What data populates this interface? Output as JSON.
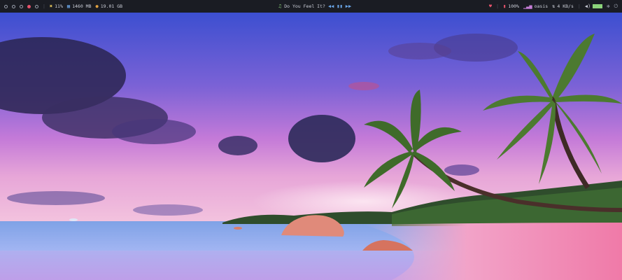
{
  "workspaces": [
    {
      "id": 1,
      "active": false
    },
    {
      "id": 2,
      "active": false
    },
    {
      "id": 3,
      "active": false
    },
    {
      "id": 4,
      "active": true
    },
    {
      "id": 5,
      "active": false
    }
  ],
  "status_left": {
    "cpu": "11%",
    "memory": "1460 MB",
    "disk": "19.01 GB"
  },
  "media": {
    "title": "Do You Feel It?"
  },
  "status_right": {
    "brightness": "100%",
    "wifi": "oasis",
    "net_speed": "4 KB/s"
  },
  "colors": {
    "bar_bg": "#1a1c23",
    "accent_red": "#e7536b",
    "accent_yellow": "#e0c25a",
    "accent_blue": "#6aa6e8",
    "accent_green": "#8bd37b"
  }
}
